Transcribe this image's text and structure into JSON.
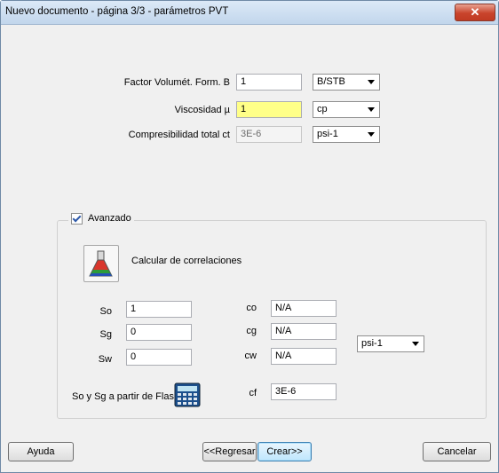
{
  "window": {
    "title": "Nuevo documento - página 3/3 - parámetros PVT",
    "close_glyph": "✕"
  },
  "pvt": {
    "b_label": "Factor Volumét. Form. B",
    "b_value": "1",
    "b_unit": "B/STB",
    "visc_label": "Viscosidad µ",
    "visc_value": "1",
    "visc_unit": "cp",
    "ct_label": "Compresibilidad total ct",
    "ct_value": "3E-6",
    "ct_unit": "psi-1"
  },
  "advanced": {
    "checkbox_label": "Avanzado",
    "checked": true,
    "correlations_label": "Calcular de correlaciones",
    "so_label": "So",
    "so_value": "1",
    "sg_label": "Sg",
    "sg_value": "0",
    "sw_label": "Sw",
    "sw_value": "0",
    "co_label": "co",
    "co_value": "N/A",
    "cg_label": "cg",
    "cg_value": "N/A",
    "cw_label": "cw",
    "cw_value": "N/A",
    "cf_label": "cf",
    "cf_value": "3E-6",
    "comp_unit": "psi-1",
    "flash_label": "So y Sg a partir de Flash"
  },
  "footer": {
    "help": "Ayuda",
    "back": "<<Regresar",
    "create": "Crear>>",
    "cancel": "Cancelar"
  },
  "colors": {
    "highlight_field": "#ffff88",
    "default_button": "#bee6fd"
  }
}
